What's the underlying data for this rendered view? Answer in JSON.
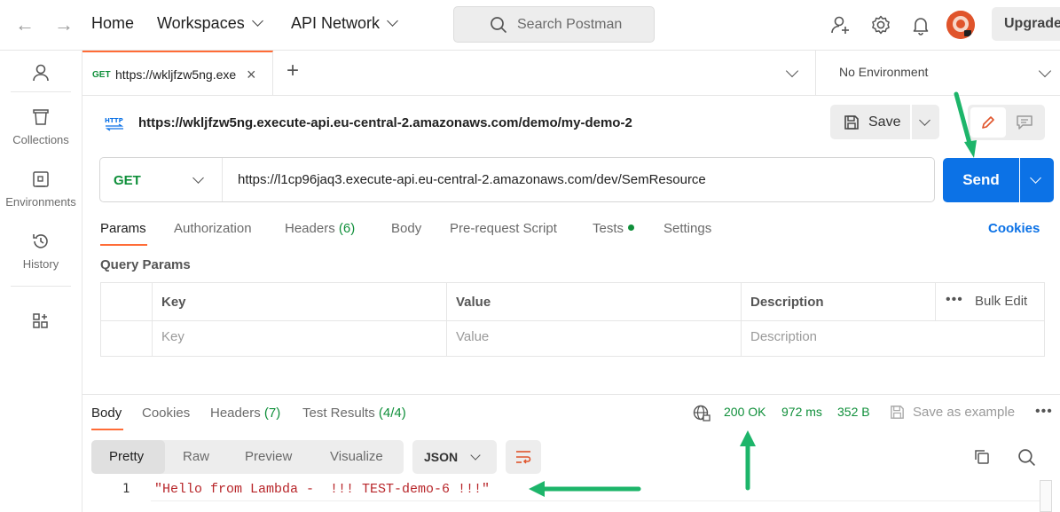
{
  "topbar": {
    "home": "Home",
    "workspaces": "Workspaces",
    "api_network": "API Network",
    "search_placeholder": "Search Postman",
    "upgrade": "Upgrade"
  },
  "sidebar": {
    "items": [
      {
        "label": "",
        "icon": "user-icon"
      },
      {
        "label": "Collections",
        "icon": "trash-can-icon"
      },
      {
        "label": "Environments",
        "icon": "environment-icon"
      },
      {
        "label": "History",
        "icon": "history-icon"
      },
      {
        "label": "",
        "icon": "apps-icon"
      }
    ]
  },
  "tabs": {
    "active": {
      "method": "GET",
      "title": "https://wkljfzw5ng.exe"
    },
    "environment": "No Environment"
  },
  "request": {
    "title": "https://wkljfzw5ng.execute-api.eu-central-2.amazonaws.com/demo/my-demo-2",
    "save": "Save",
    "method": "GET",
    "url": "https://l1cp96jaq3.execute-api.eu-central-2.amazonaws.com/dev/SemResource",
    "send": "Send",
    "subtabs": {
      "params": "Params",
      "authorization": "Authorization",
      "headers": "Headers",
      "headers_count": "(6)",
      "body": "Body",
      "prerequest": "Pre-request Script",
      "tests": "Tests",
      "settings": "Settings"
    },
    "cookies": "Cookies",
    "query_params_title": "Query Params",
    "table": {
      "headers": [
        "Key",
        "Value",
        "Description"
      ],
      "placeholders": [
        "Key",
        "Value",
        "Description"
      ],
      "bulk_edit": "Bulk Edit"
    }
  },
  "response": {
    "tabs": {
      "body": "Body",
      "cookies": "Cookies",
      "headers": "Headers",
      "headers_count": "(7)",
      "test_results": "Test Results",
      "test_results_count": "(4/4)"
    },
    "status": "200 OK",
    "time": "972 ms",
    "size": "352 B",
    "save_example": "Save as example",
    "view_modes": [
      "Pretty",
      "Raw",
      "Preview",
      "Visualize"
    ],
    "format": "JSON",
    "line_number": "1",
    "body_text": "\"Hello from Lambda -  !!! TEST-demo-6 !!!\""
  },
  "colors": {
    "accent": "#ff6c37",
    "send_blue": "#0c72e6",
    "success_green": "#0f8f3a",
    "annotation_arrow": "#1db56a"
  }
}
